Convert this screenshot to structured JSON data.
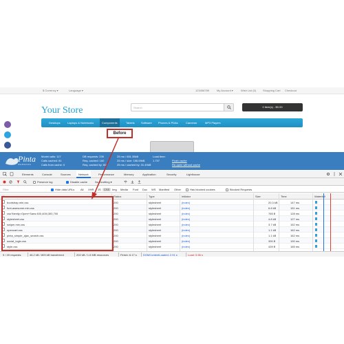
{
  "topbar": {
    "currency": "$ Currency ▾",
    "language": "Language ▾",
    "phone": "123456789",
    "my_account": "My Account ▾",
    "wish_list": "Wish List (0)",
    "shopping_cart": "Shopping Cart",
    "checkout": "Checkout"
  },
  "store": {
    "name": "Your Store",
    "search_placeholder": "Search",
    "cart": "0 item(s) - $0.00"
  },
  "menu": {
    "items": [
      "Desktops",
      "Laptops & Notebooks",
      "Components",
      "Tablets",
      "Software",
      "Phones & PDAs",
      "Cameras",
      "MP3 Players"
    ]
  },
  "annotation": {
    "label": "Before"
  },
  "debugbar": {
    "logo": "Pinta",
    "logo_sub": "WEBWARE",
    "col1": [
      "Model calls: 117",
      "Calls cached: 81",
      "Calls from cache: 0"
    ],
    "col2": [
      "DB requests: 239",
      "Req. cached: 160",
      "Req. cached by: 60"
    ],
    "col3": [
      "25 ms / 651.35kB",
      "25 ms / size: 156.69kB",
      "25 ms / cached by: 31.49kB"
    ],
    "col4": [
      "Load time:",
      "1.737"
    ],
    "flush_cache": "Flush cache",
    "reopen": "Re-open without cache"
  },
  "devtools": {
    "tabs": [
      "Elements",
      "Console",
      "Sources",
      "Network",
      "Performance",
      "Memory",
      "Application",
      "Security",
      "Lighthouse"
    ],
    "active_tab": "Network",
    "toolbar": {
      "preserve_log": "Preserve log",
      "disable_cache": "Disable cache",
      "throttling": "No throttling ▾"
    },
    "filter": {
      "placeholder": "Filter",
      "hide_data_urls": "Hide data URLs",
      "types": [
        "All",
        "XHR",
        "JS",
        "CSS",
        "Img",
        "Media",
        "Font",
        "Doc",
        "WS",
        "Manifest",
        "Other"
      ],
      "active_type": "CSS",
      "blocked_cookies": "Has blocked cookies",
      "blocked_requests": "Blocked Requests"
    },
    "columns": [
      "Name",
      "Status",
      "Type",
      "Initiator",
      "Size",
      "Time",
      "Waterfall"
    ],
    "rows": [
      {
        "name": "bootstrap.min.css",
        "status": "200",
        "type": "stylesheet",
        "initiator": "(index)",
        "size": "20.3 kB",
        "time": "147 ms"
      },
      {
        "name": "font-awesome.min.css",
        "status": "200",
        "type": "stylesheet",
        "initiator": "(index)",
        "size": "6.8 kB",
        "time": "151 ms"
      },
      {
        "name": "css?family=Open+Sans:400,400i,300,700",
        "status": "200",
        "type": "stylesheet",
        "initiator": "(index)",
        "size": "765 B",
        "time": "128 ms"
      },
      {
        "name": "stylesheet.css",
        "status": "200",
        "type": "stylesheet",
        "initiator": "(index)",
        "size": "4.8 kB",
        "time": "127 ms"
      },
      {
        "name": "swiper.min.css",
        "status": "200",
        "type": "stylesheet",
        "initiator": "(index)",
        "size": "3.7 kB",
        "time": "152 ms"
      },
      {
        "name": "opencart.css",
        "status": "200",
        "type": "stylesheet",
        "initiator": "(index)",
        "size": "1.1 kB",
        "time": "162 ms"
      },
      {
        "name": "pinta_simple_ajax_search.css",
        "status": "200",
        "type": "stylesheet",
        "initiator": "(index)",
        "size": "1.1 kB",
        "time": "162 ms"
      },
      {
        "name": "social_login.css",
        "status": "200",
        "type": "stylesheet",
        "initiator": "(index)",
        "size": "390 B",
        "time": "190 ms"
      },
      {
        "name": "style.css",
        "status": "200",
        "type": "stylesheet",
        "initiator": "(index)",
        "size": "439 B",
        "time": "165 ms"
      }
    ],
    "status_bar": {
      "requests": "9 / 49 requests",
      "transferred": "46.2 kB / 809 kB transferred",
      "resources": "202 kB / 1.6 MB resources",
      "finish": "Finish: 6.17 s",
      "dom_loaded": "DOMContentLoaded: 2.91 s",
      "load": "Load: 5.56 s"
    }
  },
  "colors": {
    "store_blue": "#23a1d1",
    "debug_bar": "#3a7ebf",
    "highlight_red": "#c0302a"
  }
}
